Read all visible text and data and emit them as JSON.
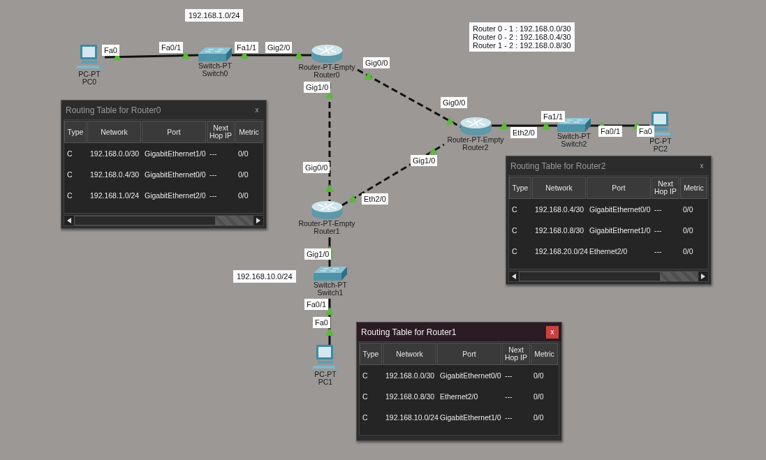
{
  "notes": [
    {
      "text": "192.168.1.0/24"
    },
    {
      "text": "Router 0 - 1 : 192.168.0.0/30\nRouter 0 - 2 : 192.168.0.4/30\nRouter 1 - 2 : 192.168.0.8/30"
    },
    {
      "text": "192.168.10.0/24"
    }
  ],
  "devices": [
    {
      "kind": "pc",
      "model": "PC-PT",
      "name": "PC0"
    },
    {
      "kind": "switch",
      "model": "Switch-PT",
      "name": "Switch0"
    },
    {
      "kind": "router",
      "model": "Router-PT-Empty",
      "name": "Router0"
    },
    {
      "kind": "router",
      "model": "Router-PT-Empty",
      "name": "Router2"
    },
    {
      "kind": "switch",
      "model": "Switch-PT",
      "name": "Switch2"
    },
    {
      "kind": "pc",
      "model": "PC-PT",
      "name": "PC2"
    },
    {
      "kind": "router",
      "model": "Router-PT-Empty",
      "name": "Router1"
    },
    {
      "kind": "switch",
      "model": "Switch-PT",
      "name": "Switch1"
    },
    {
      "kind": "pc",
      "model": "PC-PT",
      "name": "PC1"
    }
  ],
  "links": [
    {
      "kind": "straight"
    },
    {
      "kind": "straight"
    },
    {
      "kind": "crossover"
    },
    {
      "kind": "crossover"
    },
    {
      "kind": "crossover"
    },
    {
      "kind": "straight"
    },
    {
      "kind": "straight"
    },
    {
      "kind": "straight"
    },
    {
      "kind": "straight"
    }
  ],
  "ports": [
    {
      "label": "Fa0"
    },
    {
      "label": "Fa0/1"
    },
    {
      "label": "Fa1/1"
    },
    {
      "label": "Gig2/0"
    },
    {
      "label": "Gig0/0"
    },
    {
      "label": "Gig1/0"
    },
    {
      "label": "Gig0/0"
    },
    {
      "label": "Gig1/0"
    },
    {
      "label": "Gig0/0"
    },
    {
      "label": "Eth2/0"
    },
    {
      "label": "Eth2/0"
    },
    {
      "label": "Fa1/1"
    },
    {
      "label": "Fa0/1"
    },
    {
      "label": "Fa0"
    },
    {
      "label": "Gig1/0"
    },
    {
      "label": "Fa0/1"
    },
    {
      "label": "Fa0"
    }
  ],
  "routing_tables": [
    {
      "title": "Routing Table for Router0",
      "active": false,
      "scrollbar": true,
      "close": "x",
      "columns": [
        "Type",
        "Network",
        "Port",
        "Next Hop IP",
        "Metric"
      ],
      "rows": [
        [
          "C",
          "192.168.0.0/30",
          "GigabitEthernet1/0",
          "---",
          "0/0"
        ],
        [
          "C",
          "192.168.0.4/30",
          "GigabitEthernet0/0",
          "---",
          "0/0"
        ],
        [
          "C",
          "192.168.1.0/24",
          "GigabitEthernet2/0",
          "---",
          "0/0"
        ]
      ]
    },
    {
      "title": "Routing Table for Router2",
      "active": false,
      "scrollbar": true,
      "close": "x",
      "columns": [
        "Type",
        "Network",
        "Port",
        "Next Hop IP",
        "Metric"
      ],
      "rows": [
        [
          "C",
          "192.168.0.4/30",
          "GigabitEthernet0/0",
          "---",
          "0/0"
        ],
        [
          "C",
          "192.168.0.8/30",
          "GigabitEthernet1/0",
          "---",
          "0/0"
        ],
        [
          "C",
          "192.168.20.0/24",
          "Ethernet2/0",
          "---",
          "0/0"
        ]
      ]
    },
    {
      "title": "Routing Table for Router1",
      "active": true,
      "scrollbar": false,
      "close": "x",
      "columns": [
        "Type",
        "Network",
        "Port",
        "Next Hop IP",
        "Metric"
      ],
      "rows": [
        [
          "C",
          "192.168.0.0/30",
          "GigabitEthernet0/0",
          "---",
          "0/0"
        ],
        [
          "C",
          "192.168.0.8/30",
          "Ethernet2/0",
          "---",
          "0/0"
        ],
        [
          "C",
          "192.168.10.0/24",
          "GigabitEthernet1/0",
          "---",
          "0/0"
        ]
      ]
    }
  ]
}
